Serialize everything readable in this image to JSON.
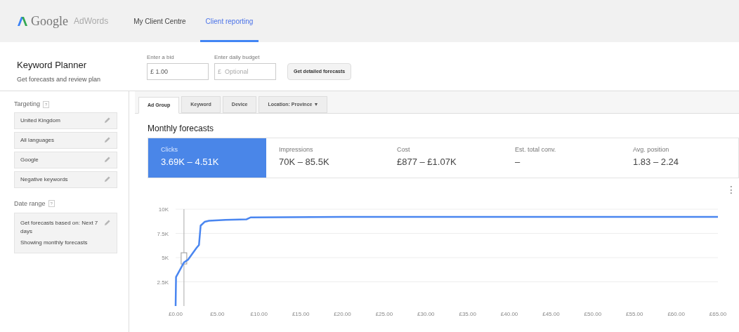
{
  "header": {
    "logo_text": "Google",
    "logo_product": "AdWords",
    "nav": [
      {
        "label": "My Client Centre",
        "selected": false
      },
      {
        "label": "Client reporting",
        "selected": true
      }
    ]
  },
  "planner": {
    "title": "Keyword Planner",
    "subtitle": "Get forecasts and review plan",
    "bid": {
      "label": "Enter a bid",
      "value": "£ 1.00"
    },
    "budget": {
      "label": "Enter daily budget",
      "placeholder": "£  Optional"
    },
    "button": "Get detailed forecasts"
  },
  "sidebar": {
    "targeting": {
      "title": "Targeting",
      "help": "?",
      "items": [
        "United Kingdom",
        "All languages",
        "Google",
        "Negative keywords"
      ]
    },
    "date_range": {
      "title": "Date range",
      "help": "?",
      "lines": [
        "Get forecasts based on: Next 7 days",
        "Showing monthly forecasts"
      ]
    }
  },
  "tabs": [
    {
      "label": "Ad Group",
      "selected": true
    },
    {
      "label": "Keyword",
      "selected": false
    },
    {
      "label": "Device",
      "selected": false
    },
    {
      "label": "Location: Province ▼",
      "selected": false
    }
  ],
  "forecasts": {
    "title": "Monthly forecasts",
    "metrics": [
      {
        "label": "Clicks",
        "value": "3.69K – 4.51K",
        "selected": true
      },
      {
        "label": "Impressions",
        "value": "70K – 85.5K",
        "selected": false
      },
      {
        "label": "Cost",
        "value": "£877 – £1.07K",
        "selected": false
      },
      {
        "label": "Est. total conv.",
        "value": "–",
        "selected": false
      },
      {
        "label": "Avg. position",
        "value": "1.83 – 2.24",
        "selected": false
      }
    ],
    "menu": "⋮",
    "chart_data": {
      "type": "line",
      "x": [
        0,
        0.05,
        0.5,
        1,
        1.5,
        2,
        2.5,
        2.8,
        3,
        3.5,
        4,
        6,
        8.5,
        9,
        20,
        40,
        65
      ],
      "grid": true,
      "ref_lines": [
        {
          "axis": "x",
          "value": 1
        }
      ],
      "series": [
        {
          "color": "#4a86f0",
          "values": [
            0,
            3000,
            3700,
            4500,
            4800,
            5400,
            6000,
            6300,
            8300,
            8700,
            8800,
            8900,
            8950,
            9150,
            9200,
            9200,
            9200
          ]
        }
      ],
      "xlim": [
        0,
        65
      ],
      "ylim": [
        0,
        10000
      ],
      "xticks": [
        {
          "value": 0,
          "label": "£0.00"
        },
        {
          "value": 5,
          "label": "£5.00"
        },
        {
          "value": 10,
          "label": "£10.00"
        },
        {
          "value": 15,
          "label": "£15.00"
        },
        {
          "value": 20,
          "label": "£20.00"
        },
        {
          "value": 25,
          "label": "£25.00"
        },
        {
          "value": 30,
          "label": "£30.00"
        },
        {
          "value": 35,
          "label": "£35.00"
        },
        {
          "value": 40,
          "label": "£40.00"
        },
        {
          "value": 45,
          "label": "£45.00"
        },
        {
          "value": 50,
          "label": "£50.00"
        },
        {
          "value": 55,
          "label": "£55.00"
        },
        {
          "value": 60,
          "label": "£60.00"
        },
        {
          "value": 65,
          "label": "£65.00"
        }
      ],
      "yticks": [
        {
          "value": 2500,
          "label": "2.5K"
        },
        {
          "value": 5000,
          "label": "5K"
        },
        {
          "value": 7500,
          "label": "7.5K"
        },
        {
          "value": 10000,
          "label": "10K"
        }
      ]
    }
  }
}
